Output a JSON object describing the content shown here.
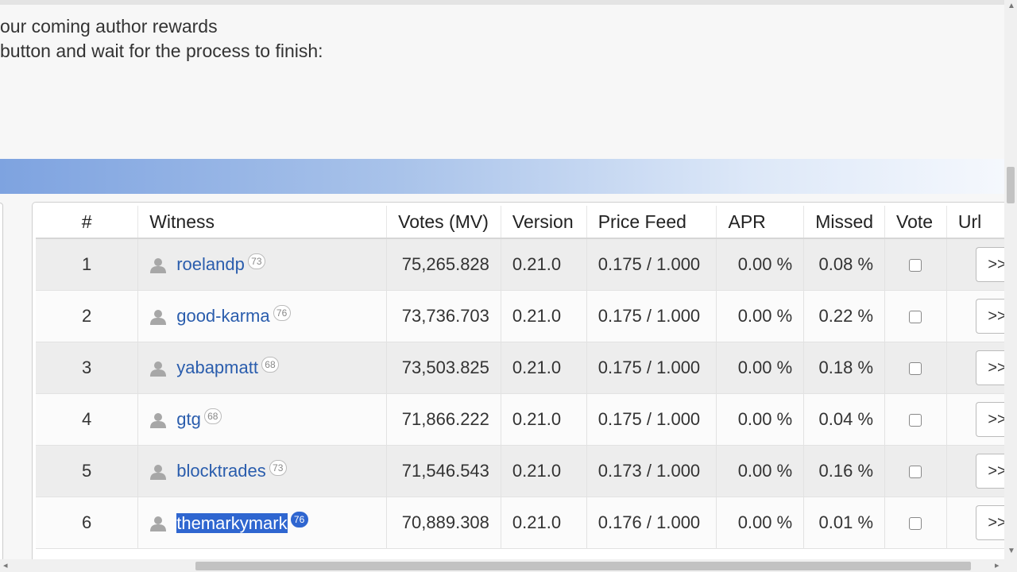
{
  "intro": {
    "line1": "our coming author rewards",
    "line2": "button and wait for the process to finish:"
  },
  "table": {
    "headers": [
      "#",
      "Witness",
      "Votes (MV)",
      "Version",
      "Price Feed",
      "APR",
      "Missed",
      "Vote",
      "Url"
    ],
    "rows": [
      {
        "rank": "1",
        "name": "roelandp",
        "rep": "73",
        "votes": "75,265.828",
        "version": "0.21.0",
        "price_feed": "0.175 / 1.000",
        "apr": "0.00 %",
        "missed": "0.08 %",
        "url_label": ">>"
      },
      {
        "rank": "2",
        "name": "good-karma",
        "rep": "76",
        "votes": "73,736.703",
        "version": "0.21.0",
        "price_feed": "0.175 / 1.000",
        "apr": "0.00 %",
        "missed": "0.22 %",
        "url_label": ">>"
      },
      {
        "rank": "3",
        "name": "yabapmatt",
        "rep": "68",
        "votes": "73,503.825",
        "version": "0.21.0",
        "price_feed": "0.175 / 1.000",
        "apr": "0.00 %",
        "missed": "0.18 %",
        "url_label": ">>"
      },
      {
        "rank": "4",
        "name": "gtg",
        "rep": "68",
        "votes": "71,866.222",
        "version": "0.21.0",
        "price_feed": "0.175 / 1.000",
        "apr": "0.00 %",
        "missed": "0.04 %",
        "url_label": ">>"
      },
      {
        "rank": "5",
        "name": "blocktrades",
        "rep": "73",
        "votes": "71,546.543",
        "version": "0.21.0",
        "price_feed": "0.173 / 1.000",
        "apr": "0.00 %",
        "missed": "0.16 %",
        "url_label": ">>"
      },
      {
        "rank": "6",
        "name": "themarkymark",
        "rep": "76",
        "votes": "70,889.308",
        "version": "0.21.0",
        "price_feed": "0.176 / 1.000",
        "apr": "0.00 %",
        "missed": "0.01 %",
        "url_label": ">>"
      }
    ]
  },
  "colors": {
    "link": "#2a5dad",
    "selection": "#2f66d0",
    "banner_start": "#7ea3e0"
  }
}
